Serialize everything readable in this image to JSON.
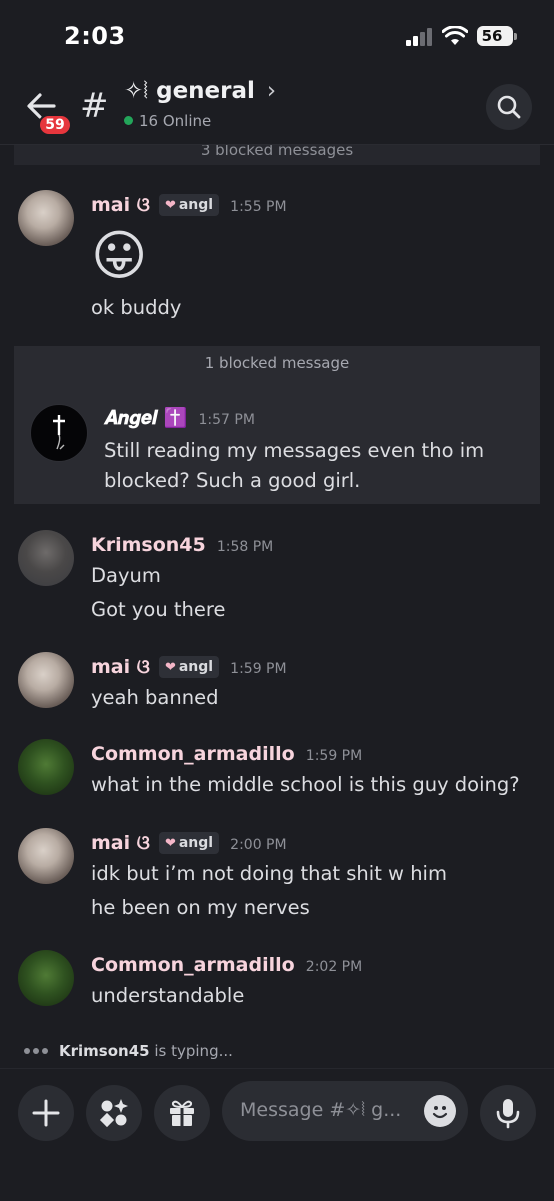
{
  "status": {
    "time": "2:03",
    "battery": "56"
  },
  "header": {
    "unread_badge": "59",
    "channel_prefix": "✧⦚",
    "channel_name": "general",
    "online": "16 Online"
  },
  "blocked_top": "3 blocked messages",
  "messages": [
    {
      "user": "mai ଓ",
      "tag": "angl",
      "time": "1:55 PM",
      "emoji": "😛",
      "lines": [
        "ok buddy"
      ],
      "name_color": "#f7d4dd"
    },
    {
      "user": "𝑨𝒏𝒈𝒆𝒍 ✝️",
      "time": "1:57 PM",
      "lines": [
        "Still reading my messages even tho im",
        "blocked? Such a good girl."
      ],
      "name_color": "#ffffff"
    },
    {
      "user": "Krimson45",
      "time": "1:58 PM",
      "lines": [
        "Dayum",
        "Got you there"
      ],
      "name_color": "#f7d4dd"
    },
    {
      "user": "mai ଓ",
      "tag": "angl",
      "time": "1:59 PM",
      "lines": [
        "yeah banned"
      ],
      "name_color": "#f7d4dd"
    },
    {
      "user": "Common_armadillo",
      "time": "1:59 PM",
      "lines": [
        "what in the middle school is this guy doing?"
      ],
      "name_color": "#f7d4dd"
    },
    {
      "user": "mai ଓ",
      "tag": "angl",
      "time": "2:00 PM",
      "lines": [
        "idk but i’m not doing that shit w him",
        "he been on my nerves"
      ],
      "name_color": "#f7d4dd"
    },
    {
      "user": "Common_armadillo",
      "time": "2:02 PM",
      "lines": [
        "understandable"
      ],
      "name_color": "#f7d4dd"
    }
  ],
  "blocked_box_label": "1 blocked message",
  "typing": {
    "user": "Krimson45",
    "suffix": " is typing..."
  },
  "composer": {
    "placeholder": "Message #✧⦚  g..."
  },
  "icons": [
    "back-arrow-icon",
    "hash-icon",
    "search-icon",
    "plus-icon",
    "apps-icon",
    "gift-icon",
    "emoji-icon",
    "microphone-icon"
  ]
}
